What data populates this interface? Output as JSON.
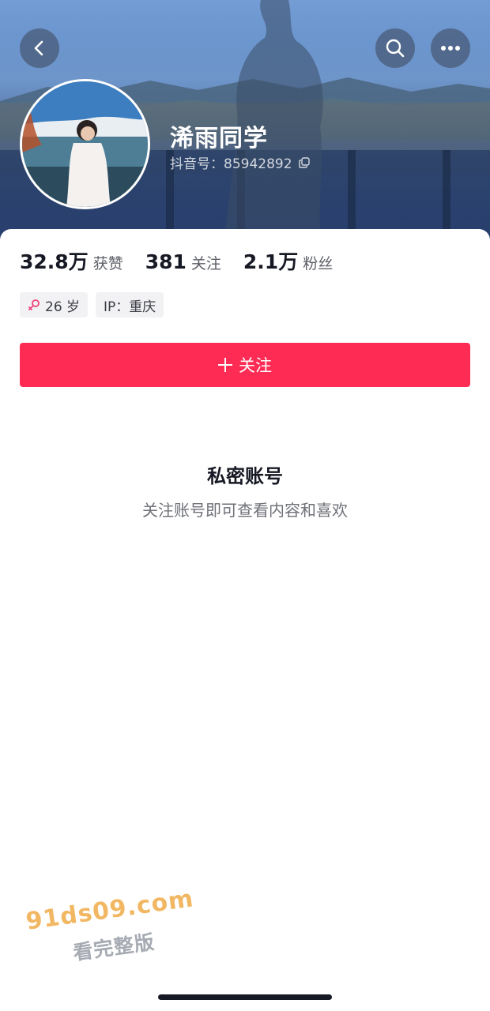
{
  "header": {
    "back_icon": "chevron-left-icon",
    "search_icon": "search-icon",
    "more_icon": "more-dots-icon"
  },
  "profile": {
    "display_name": "浠雨同学",
    "id_label": "抖音号：",
    "id_value": "85942892",
    "copy_icon": "copy-icon"
  },
  "stats": [
    {
      "value": "32.8万",
      "label": "获赞"
    },
    {
      "value": "381",
      "label": "关注"
    },
    {
      "value": "2.1万",
      "label": "粉丝"
    }
  ],
  "tags": {
    "age": "26 岁",
    "gender_icon": "female-icon",
    "ip": "IP：重庆"
  },
  "follow_button": {
    "label": "关注",
    "icon": "plus-icon",
    "color": "#fe2c55"
  },
  "private": {
    "title": "私密账号",
    "subtitle": "关注账号即可查看内容和喜欢"
  },
  "watermark": {
    "url": "91ds09.com",
    "text": "看完整版"
  }
}
